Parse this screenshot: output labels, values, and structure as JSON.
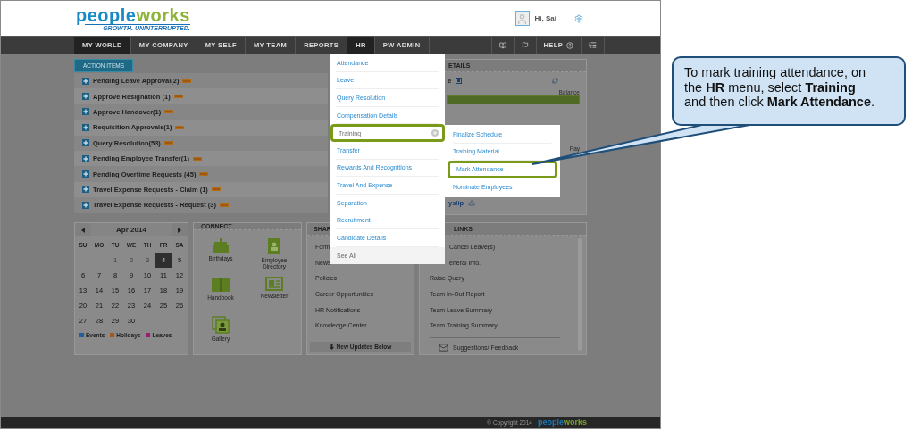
{
  "header": {
    "logo": {
      "brand_start": "people",
      "brand_end": "works",
      "tagline": "GROWTH. UNINTERRUPTED."
    },
    "greeting": "Hi, Sai"
  },
  "nav": {
    "items": [
      {
        "label": "MY WORLD",
        "selected": true
      },
      {
        "label": "MY COMPANY",
        "selected": false
      },
      {
        "label": "MY SELF",
        "selected": false
      },
      {
        "label": "MY TEAM",
        "selected": false
      },
      {
        "label": "REPORTS",
        "selected": false
      },
      {
        "label": "HR",
        "selected": true
      },
      {
        "label": "PW ADMIN",
        "selected": false
      }
    ],
    "help": "HELP"
  },
  "action_items": {
    "tab": "ACTION ITEMS",
    "rows": [
      {
        "label": "Pending Leave Approval(2)",
        "new": true
      },
      {
        "label": "Approve Resignation (1)",
        "new": true
      },
      {
        "label": "Approve Handover(1)",
        "new": true
      },
      {
        "label": "Requisition Approvals(1)",
        "new": true
      },
      {
        "label": "Query Resolution(53)",
        "new": true
      },
      {
        "label": "Pending Employee Transfer(1)",
        "new": true
      },
      {
        "label": "Pending Overtime Requests (45)",
        "new": true
      },
      {
        "label": "Travel Expense Requests - Claim (1)",
        "new": true
      },
      {
        "label": "Travel Expense Requests - Request (3)",
        "new": true
      }
    ]
  },
  "details_panel": {
    "title": "ETAILS",
    "subtitle": "e",
    "balance_label": "Balance",
    "pay_label": "Pay",
    "payslip_link": "yslip"
  },
  "hr_menu": {
    "items": [
      {
        "label": "Attendance",
        "kind": "link",
        "selected": false
      },
      {
        "label": "Leave",
        "kind": "link",
        "selected": false
      },
      {
        "label": "Query Resolution",
        "kind": "link",
        "selected": false
      },
      {
        "label": "Compensation Details",
        "kind": "link",
        "selected": false
      },
      {
        "label": "Training",
        "kind": "submenu",
        "selected": true
      },
      {
        "label": "Transfer",
        "kind": "link",
        "selected": false
      },
      {
        "label": "Rewards And Recognitions",
        "kind": "link",
        "selected": false
      },
      {
        "label": "Travel And Expense",
        "kind": "link",
        "selected": false
      },
      {
        "label": "Separation",
        "kind": "link",
        "selected": false
      },
      {
        "label": "Recruitment",
        "kind": "link",
        "selected": false
      },
      {
        "label": "Candidate Details",
        "kind": "link",
        "selected": false
      },
      {
        "label": "See All",
        "kind": "footer",
        "selected": false
      }
    ]
  },
  "training_submenu": {
    "items": [
      {
        "label": "Finalize Schedule",
        "selected": false
      },
      {
        "label": "Training Material",
        "selected": false
      },
      {
        "label": "Mark Attendance",
        "selected": true
      },
      {
        "label": "Nominate Employees",
        "selected": false
      }
    ]
  },
  "calendar": {
    "month": "Apr 2014",
    "weekdays": [
      "SU",
      "MO",
      "TU",
      "WE",
      "TH",
      "FR",
      "SA"
    ],
    "weeks": [
      [
        {
          "day": "1",
          "muted": true,
          "selected": false
        },
        {
          "day": "2",
          "muted": true,
          "selected": false
        },
        {
          "day": "3",
          "muted": true,
          "selected": false
        },
        {
          "day": "4",
          "muted": false,
          "selected": true
        },
        {
          "day": "5",
          "muted": false,
          "selected": false
        }
      ],
      [
        {
          "day": "6",
          "muted": false,
          "selected": false
        },
        {
          "day": "7",
          "muted": false,
          "selected": false
        },
        {
          "day": "8",
          "muted": false,
          "selected": false
        },
        {
          "day": "9",
          "muted": false,
          "selected": false
        },
        {
          "day": "10",
          "muted": false,
          "selected": false
        },
        {
          "day": "11",
          "muted": false,
          "selected": false
        },
        {
          "day": "12",
          "muted": false,
          "selected": false
        }
      ],
      [
        {
          "day": "13",
          "muted": false,
          "selected": false
        },
        {
          "day": "14",
          "muted": false,
          "selected": false
        },
        {
          "day": "15",
          "muted": false,
          "selected": false
        },
        {
          "day": "16",
          "muted": false,
          "selected": false
        },
        {
          "day": "17",
          "muted": false,
          "selected": false
        },
        {
          "day": "18",
          "muted": false,
          "selected": false
        },
        {
          "day": "19",
          "muted": false,
          "selected": false
        }
      ],
      [
        {
          "day": "20",
          "muted": false,
          "selected": false
        },
        {
          "day": "21",
          "muted": false,
          "selected": false
        },
        {
          "day": "22",
          "muted": false,
          "selected": false
        },
        {
          "day": "23",
          "muted": false,
          "selected": false
        },
        {
          "day": "24",
          "muted": false,
          "selected": false
        },
        {
          "day": "25",
          "muted": false,
          "selected": false
        },
        {
          "day": "26",
          "muted": false,
          "selected": false
        }
      ],
      [
        {
          "day": "27",
          "muted": false,
          "selected": false
        },
        {
          "day": "28",
          "muted": false,
          "selected": false
        },
        {
          "day": "29",
          "muted": false,
          "selected": false
        },
        {
          "day": "30",
          "muted": false,
          "selected": false
        }
      ]
    ],
    "legend": [
      {
        "label": "Events",
        "color": "#1f5f9a"
      },
      {
        "label": "Holidays",
        "color": "#a8571c"
      },
      {
        "label": "Leaves",
        "color": "#9a1f72"
      }
    ]
  },
  "connect": {
    "title": "CONNECT",
    "items": [
      {
        "label": "Birthdays",
        "kind": "cake"
      },
      {
        "label": "Employee Directory",
        "kind": "directory"
      },
      {
        "label": "Handbook",
        "kind": "handbook"
      },
      {
        "label": "Newsletter",
        "kind": "newsletter"
      },
      {
        "label": "Gallery",
        "kind": "gallery"
      }
    ]
  },
  "shared_panel": {
    "title": "SHAR",
    "items": [
      "Form",
      "News",
      "Policies",
      "Career Opportunities",
      "HR Notifications",
      "Knowledge Center"
    ],
    "footer": "New Updates Below"
  },
  "quick_links": {
    "title": "LINKS",
    "items": [
      "Cancel Leave(s)",
      "eneral Info.",
      "Raise Query",
      "Team In-Out Report",
      "Team Leave Summary",
      "Team Training Summary"
    ],
    "feedback": "Suggestions/ Feedback"
  },
  "footer": {
    "copyright": "© Copyright 2014",
    "logo": {
      "brand_start": "people",
      "brand_end": "works"
    }
  },
  "callout": {
    "text": "To mark training attendance, on the **HR** menu, select **Training** and then click **Mark Attendance**."
  }
}
